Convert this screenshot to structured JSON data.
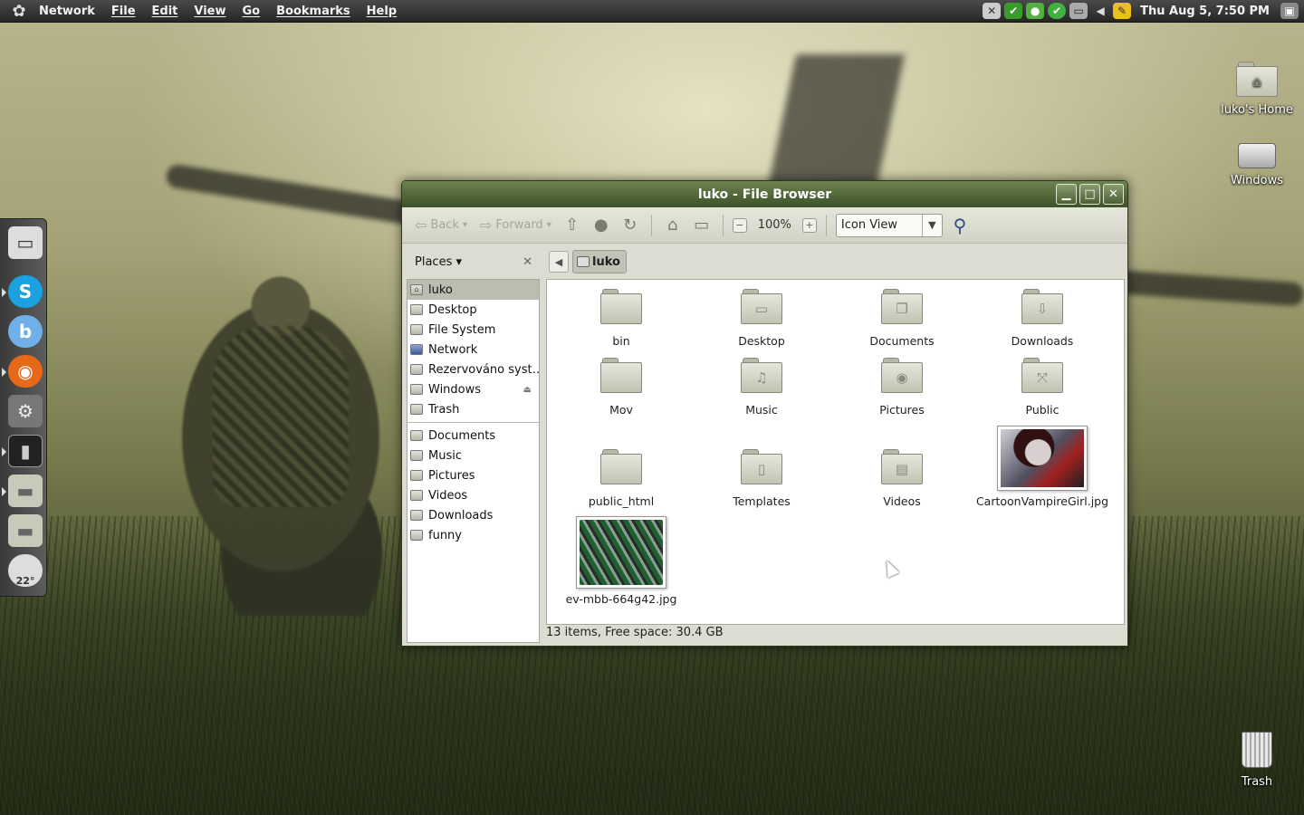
{
  "panel": {
    "menus": [
      "Network",
      "File",
      "Edit",
      "View",
      "Go",
      "Bookmarks",
      "Help"
    ],
    "clock": "Thu Aug  5, 7:50 PM",
    "tray_icons": [
      "network-x-icon",
      "check-icon",
      "chat-icon",
      "shield-check-icon",
      "display-icon",
      "volume-icon",
      "notes-icon"
    ]
  },
  "dock": {
    "weather_temp": "22°",
    "apps": [
      "desktop-icon",
      "skype-icon",
      "b-app-icon",
      "firefox-icon",
      "apps-icon",
      "terminal-icon",
      "folder-icon",
      "folder-icon",
      "weather-icon"
    ]
  },
  "desktop_icons": [
    {
      "label": "luko's Home",
      "icon": "home-folder-icon"
    },
    {
      "label": "Windows",
      "icon": "drive-icon"
    },
    {
      "label": "Trash",
      "icon": "trash-icon"
    }
  ],
  "window": {
    "title": "luko - File Browser",
    "toolbar": {
      "back": "Back",
      "forward": "Forward",
      "zoom": "100%",
      "view_mode": "Icon View"
    },
    "sidebar_title": "Places",
    "places": [
      {
        "label": "luko",
        "selected": true
      },
      {
        "label": "Desktop"
      },
      {
        "label": "File System"
      },
      {
        "label": "Network"
      },
      {
        "label": "Rezervováno syst…"
      },
      {
        "label": "Windows",
        "eject": true
      },
      {
        "label": "Trash"
      }
    ],
    "bookmarks": [
      "Documents",
      "Music",
      "Pictures",
      "Videos",
      "Downloads",
      "funny"
    ],
    "path": "luko",
    "files": [
      {
        "name": "bin",
        "glyph": ""
      },
      {
        "name": "Desktop",
        "glyph": "▭"
      },
      {
        "name": "Documents",
        "glyph": "❐"
      },
      {
        "name": "Downloads",
        "glyph": "⇩"
      },
      {
        "name": "Mov",
        "glyph": ""
      },
      {
        "name": "Music",
        "glyph": "♫"
      },
      {
        "name": "Pictures",
        "glyph": "◉"
      },
      {
        "name": "Public",
        "glyph": "⤧"
      },
      {
        "name": "public_html",
        "glyph": ""
      },
      {
        "name": "Templates",
        "glyph": "▯"
      },
      {
        "name": "Videos",
        "glyph": "▤"
      },
      {
        "name": "CartoonVampireGirl.jpg",
        "thumb": true
      },
      {
        "name": "ev-mbb-664g42.jpg",
        "thumb": true
      }
    ],
    "status": "13 items, Free space: 30.4 GB"
  }
}
